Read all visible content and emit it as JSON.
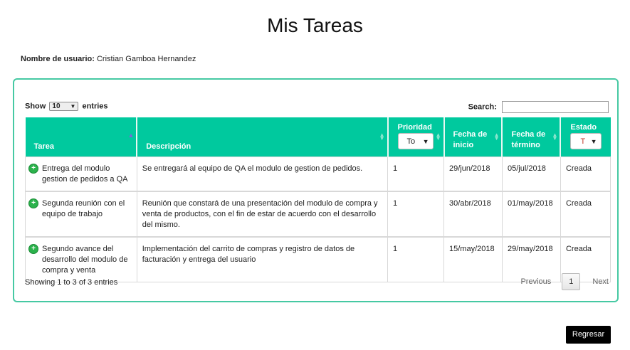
{
  "page": {
    "title": "Mis Tareas"
  },
  "user": {
    "label": "Nombre de usuario:",
    "name": "Cristian Gamboa Hernandez"
  },
  "table_controls": {
    "show_label": "Show",
    "page_length": "10",
    "entries_label": "entries",
    "search_label": "Search:",
    "search_value": ""
  },
  "columns": {
    "tarea": "Tarea",
    "descripcion": "Descripción",
    "prioridad": "Prioridad",
    "prioridad_filter": "To",
    "fecha_inicio": "Fecha de inicio",
    "fecha_termino": "Fecha de término",
    "estado": "Estado",
    "estado_filter": "T"
  },
  "rows": [
    {
      "tarea": "Entrega del modulo gestion de pedidos a QA",
      "descripcion": "Se entregará al equipo de QA el modulo de gestion de pedidos.",
      "prioridad": "1",
      "inicio": "29/jun/2018",
      "termino": "05/jul/2018",
      "estado": "Creada"
    },
    {
      "tarea": "Segunda reunión con el equipo de trabajo",
      "descripcion": "Reunión que constará de una presentación del modulo de compra y venta de productos, con el fin de estar de acuerdo con el desarrollo del mismo.",
      "prioridad": "1",
      "inicio": "30/abr/2018",
      "termino": "01/may/2018",
      "estado": "Creada"
    },
    {
      "tarea": "Segundo avance del desarrollo del modulo de compra y venta",
      "descripcion": "Implementación del carrito de compras y registro de datos de facturación y entrega del usuario",
      "prioridad": "1",
      "inicio": "15/may/2018",
      "termino": "29/may/2018",
      "estado": "Creada"
    }
  ],
  "footer": {
    "info": "Showing 1 to 3 of 3 entries",
    "previous": "Previous",
    "current_page": "1",
    "next": "Next"
  },
  "actions": {
    "back": "Regresar"
  },
  "colors": {
    "header": "#00c99e",
    "panel_border": "#46c9a3",
    "expand": "#2bb24c"
  },
  "icons": {
    "expand": "plus-circle-icon",
    "sort": "sort-arrows-icon",
    "dropdown": "caret-down-icon"
  }
}
